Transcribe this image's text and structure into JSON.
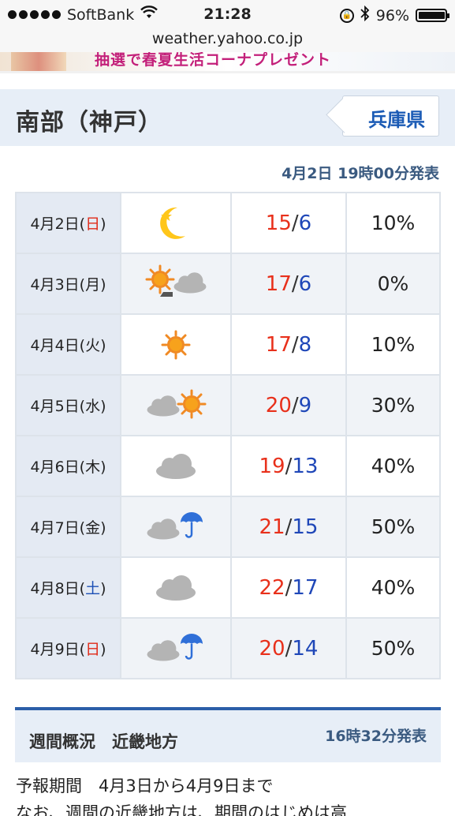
{
  "status_bar": {
    "carrier": "SoftBank",
    "time": "21:28",
    "battery": "96%",
    "battery_level": 0.96
  },
  "url": "weather.yahoo.co.jp",
  "banner": {
    "text": "抽選で春夏生活コーナプレゼント"
  },
  "header": {
    "title": "南部（神戸）",
    "pref_button": "兵庫県"
  },
  "issued": "4月2日 19時00分発表",
  "forecast": [
    {
      "date_pre": "4月2日(",
      "weekday": "日",
      "date_post": ")",
      "weekday_color": "red",
      "icon": "moon-star-icon",
      "high": "15",
      "low": "6",
      "pop": "10%"
    },
    {
      "date_pre": "4月3日(",
      "weekday": "月",
      "date_post": ")",
      "weekday_color": "plain",
      "icon": "sun-then-cloud-icon",
      "high": "17",
      "low": "6",
      "pop": "0%"
    },
    {
      "date_pre": "4月4日(",
      "weekday": "火",
      "date_post": ")",
      "weekday_color": "plain",
      "icon": "sun-icon",
      "high": "17",
      "low": "8",
      "pop": "10%"
    },
    {
      "date_pre": "4月5日(",
      "weekday": "水",
      "date_post": ")",
      "weekday_color": "plain",
      "icon": "cloud-sun-icon",
      "high": "20",
      "low": "9",
      "pop": "30%"
    },
    {
      "date_pre": "4月6日(",
      "weekday": "木",
      "date_post": ")",
      "weekday_color": "plain",
      "icon": "cloud-icon",
      "high": "19",
      "low": "13",
      "pop": "40%"
    },
    {
      "date_pre": "4月7日(",
      "weekday": "金",
      "date_post": ")",
      "weekday_color": "plain",
      "icon": "cloud-rain-icon",
      "high": "21",
      "low": "15",
      "pop": "50%"
    },
    {
      "date_pre": "4月8日(",
      "weekday": "土",
      "date_post": ")",
      "weekday_color": "blue",
      "icon": "cloud-icon",
      "high": "22",
      "low": "17",
      "pop": "40%"
    },
    {
      "date_pre": "4月9日(",
      "weekday": "日",
      "date_post": ")",
      "weekday_color": "red",
      "icon": "cloud-rain-icon",
      "high": "20",
      "low": "14",
      "pop": "50%"
    }
  ],
  "weekly": {
    "title": "週間概況　近畿地方",
    "issued": "16時32分発表",
    "period": "予報期間　4月3日から4月9日まで",
    "body": "なお、週間の近畿地方は、期間のはじめは高"
  },
  "colors": {
    "high": "#e8301b",
    "low": "#1f47b8",
    "accent": "#2b5ea8",
    "header_bg": "#e7eef7"
  }
}
